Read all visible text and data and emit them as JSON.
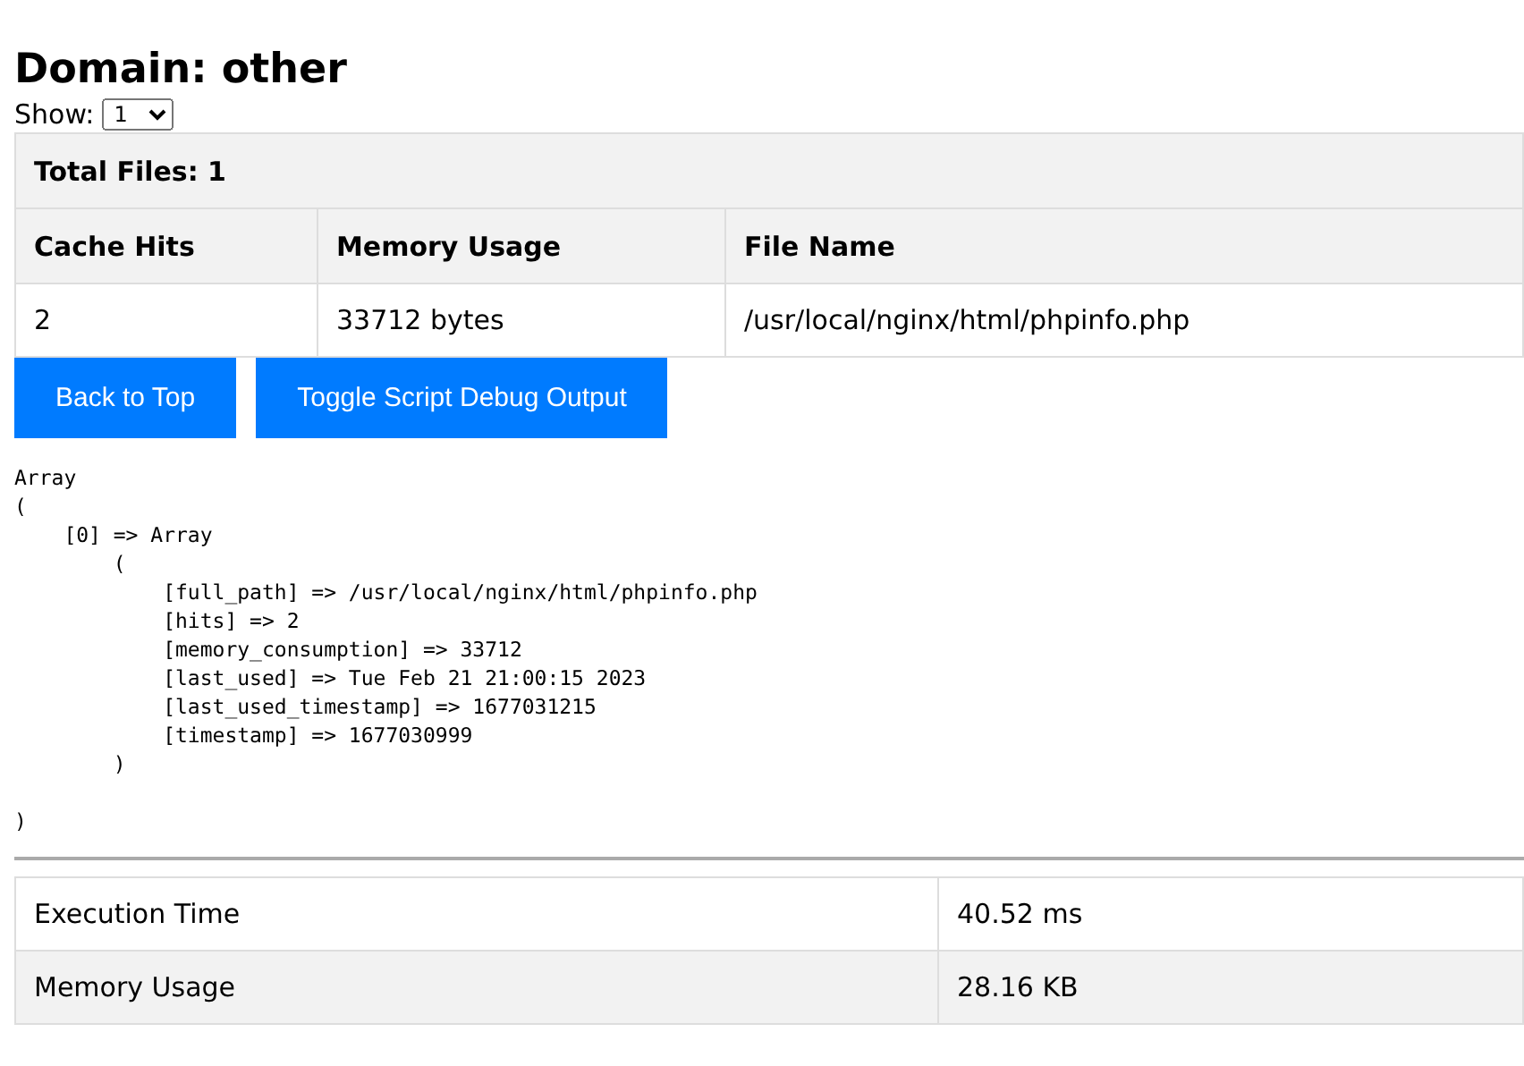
{
  "title": "Domain: other",
  "show": {
    "label": "Show:",
    "value": "1"
  },
  "files_table": {
    "caption": "Total Files: 1",
    "columns": [
      "Cache Hits",
      "Memory Usage",
      "File Name"
    ],
    "rows": [
      [
        "2",
        "33712 bytes",
        "/usr/local/nginx/html/phpinfo.php"
      ]
    ]
  },
  "buttons": [
    "Back to Top",
    "Toggle Script Debug Output"
  ],
  "debug_output": "Array\n(\n    [0] => Array\n        (\n            [full_path] => /usr/local/nginx/html/phpinfo.php\n            [hits] => 2\n            [memory_consumption] => 33712\n            [last_used] => Tue Feb 21 21:00:15 2023\n            [last_used_timestamp] => 1677031215\n            [timestamp] => 1677030999\n        )\n\n)",
  "stats": [
    {
      "label": "Execution Time",
      "value": "40.52 ms"
    },
    {
      "label": "Memory Usage",
      "value": "28.16 KB"
    }
  ]
}
